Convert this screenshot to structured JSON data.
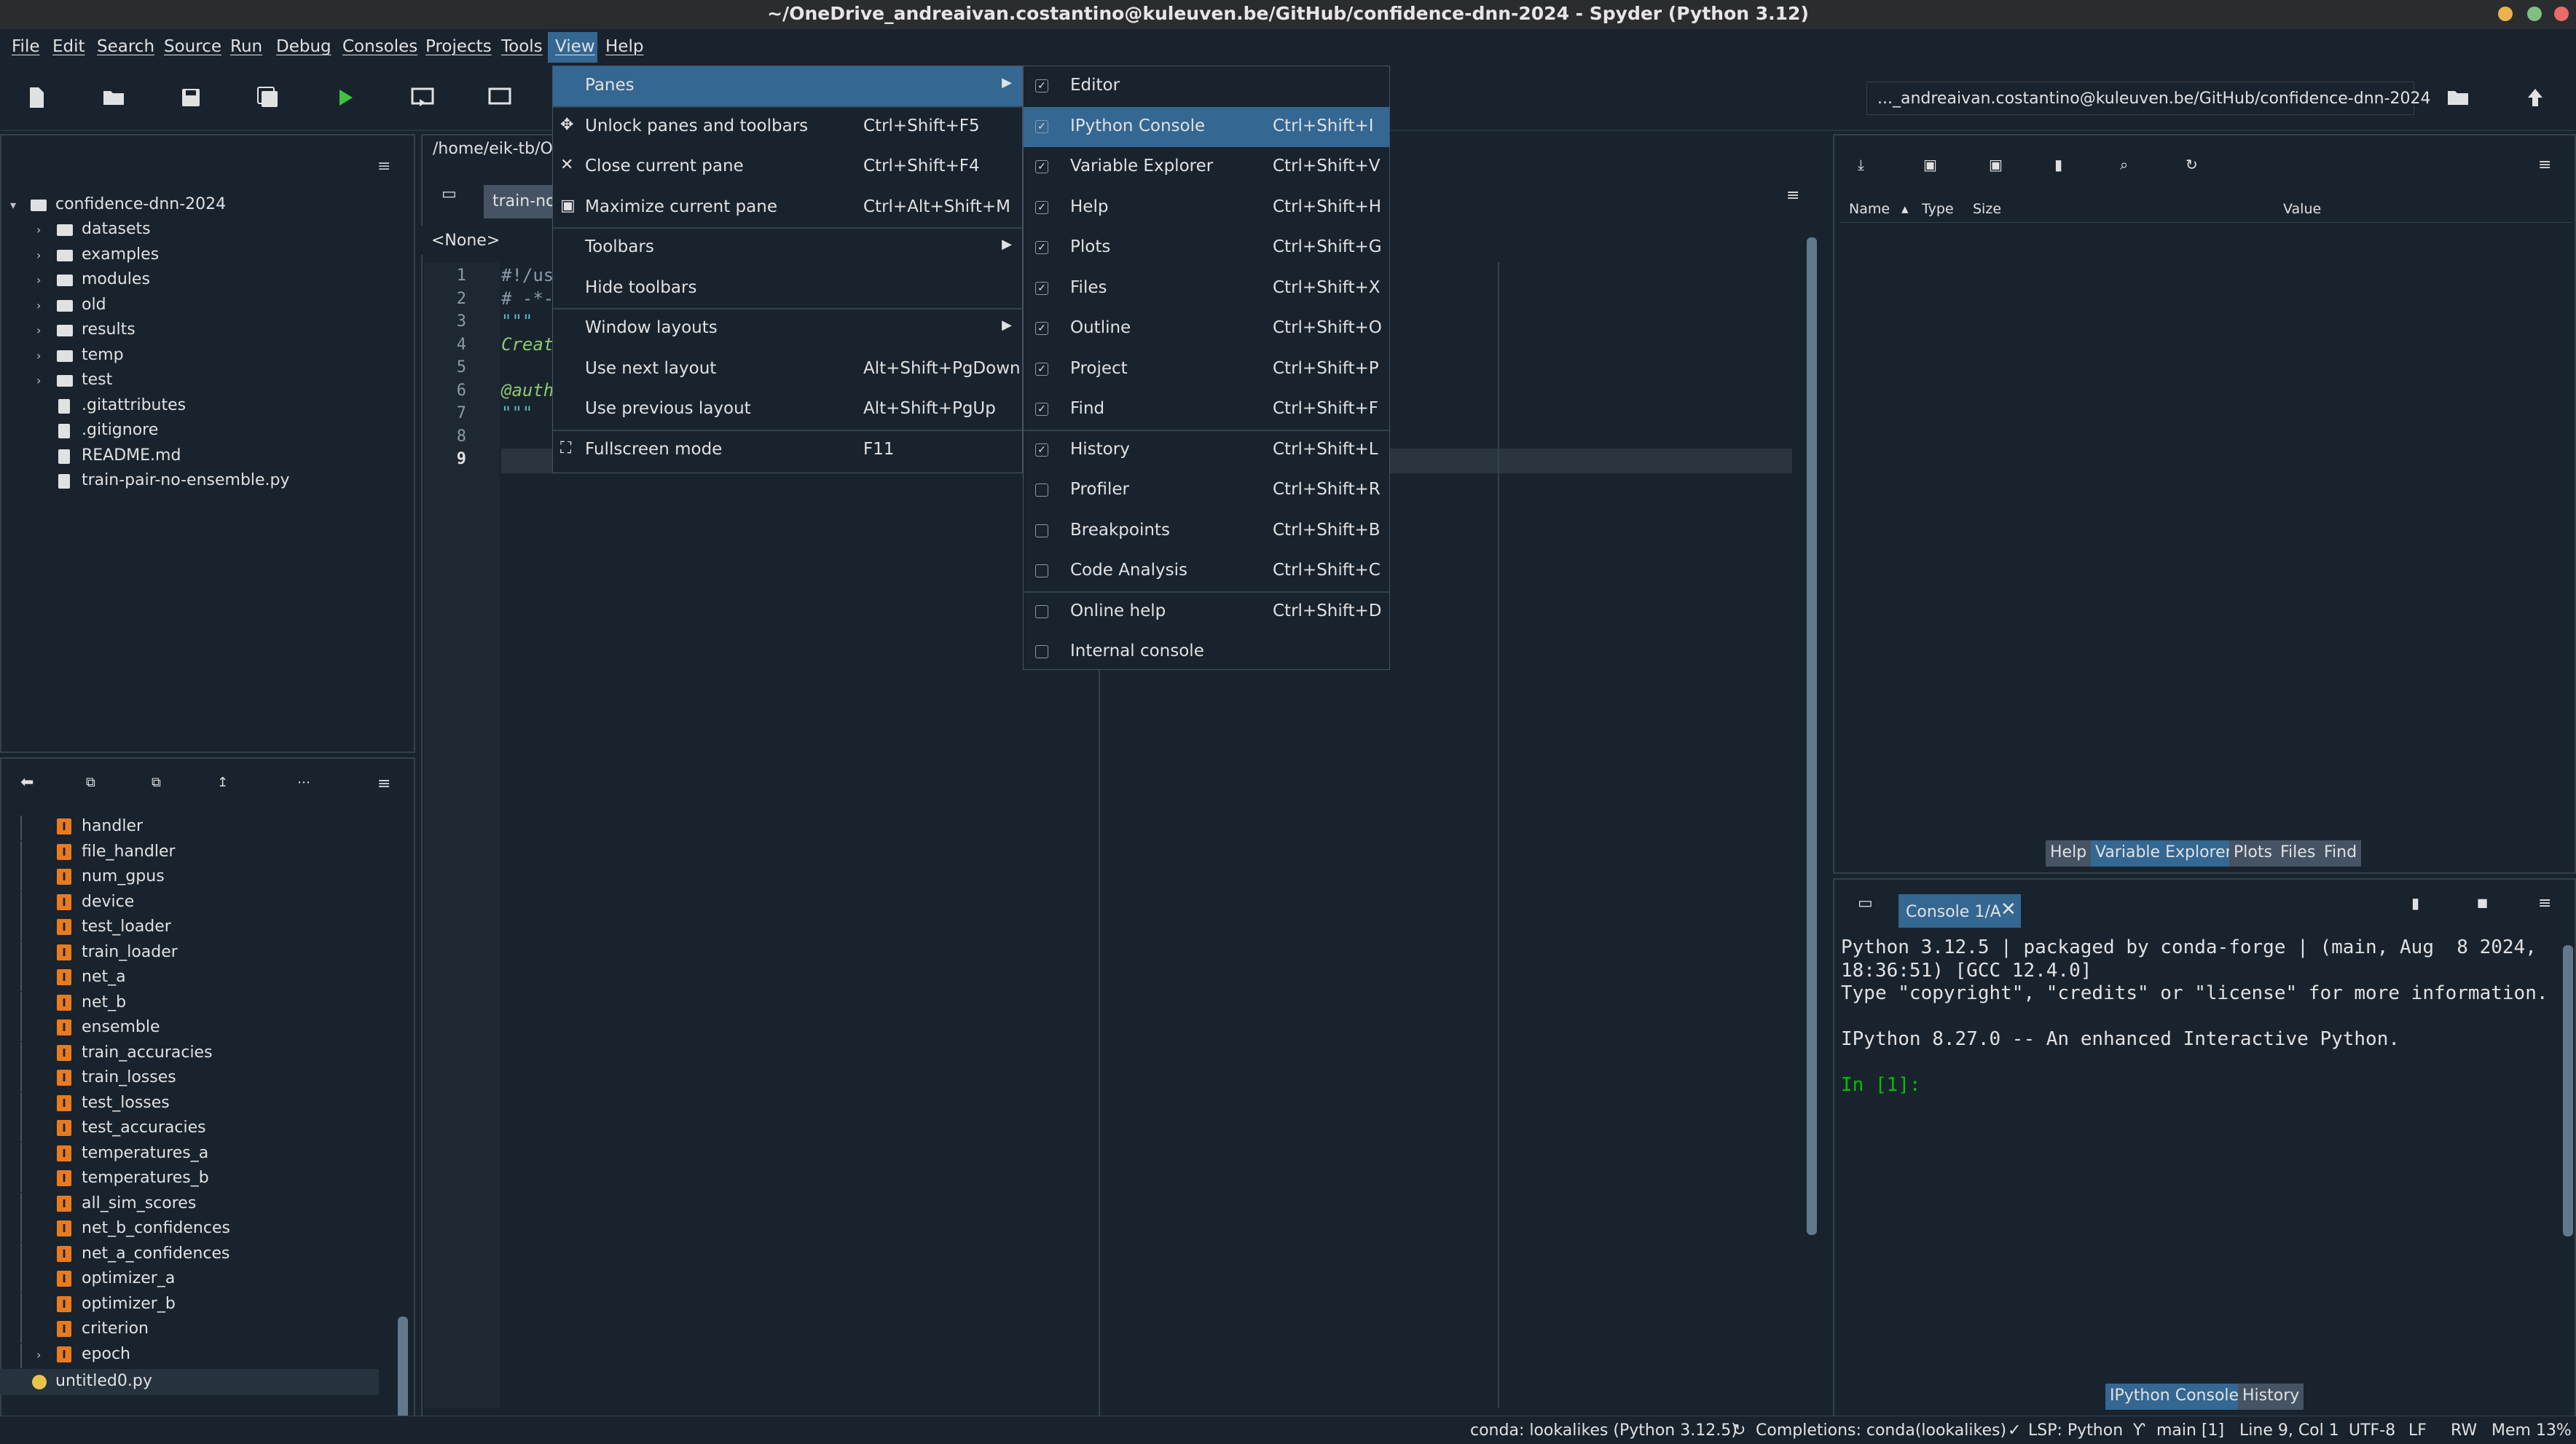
{
  "window": {
    "title": "~/OneDrive_andreaivan.costantino@kuleuven.be/GitHub/confidence-dnn-2024 - Spyder (Python 3.12)"
  },
  "menubar": [
    "File",
    "Edit",
    "Search",
    "Source",
    "Run",
    "Debug",
    "Consoles",
    "Projects",
    "Tools",
    "View",
    "Help"
  ],
  "toolbar": {
    "path": "..._andreaivan.costantino@kuleuven.be/GitHub/confidence-dnn-2024"
  },
  "files_tree": {
    "root": "confidence-dnn-2024",
    "items": [
      {
        "label": "datasets",
        "kind": "folder"
      },
      {
        "label": "examples",
        "kind": "folder"
      },
      {
        "label": "modules",
        "kind": "folder"
      },
      {
        "label": "old",
        "kind": "folder"
      },
      {
        "label": "results",
        "kind": "folder"
      },
      {
        "label": "temp",
        "kind": "folder"
      },
      {
        "label": "test",
        "kind": "folder"
      },
      {
        "label": ".gitattributes",
        "kind": "file"
      },
      {
        "label": ".gitignore",
        "kind": "file"
      },
      {
        "label": "README.md",
        "kind": "file"
      },
      {
        "label": "train-pair-no-ensemble.py",
        "kind": "file"
      }
    ]
  },
  "outline": {
    "items": [
      "handler",
      "file_handler",
      "num_gpus",
      "device",
      "test_loader",
      "train_loader",
      "net_a",
      "net_b",
      "ensemble",
      "train_accuracies",
      "train_losses",
      "test_losses",
      "test_accuracies",
      "temperatures_a",
      "temperatures_b",
      "all_sim_scores",
      "net_b_confidences",
      "net_a_confidences",
      "optimizer_a",
      "optimizer_b",
      "criterion",
      "epoch"
    ],
    "file": "untitled0.py",
    "var_glyph": "I"
  },
  "editor": {
    "path": "/home/eik-tb/Or",
    "tab": "train-no",
    "selector": "<None>",
    "line_numbers": [
      "1",
      "2",
      "3",
      "4",
      "5",
      "6",
      "7",
      "8",
      "9"
    ],
    "lines": [
      "#!/us",
      "# -*-",
      "\"\"\"",
      "Creat",
      "",
      "@auth",
      "\"\"\"",
      "",
      ""
    ]
  },
  "view_menu": {
    "items": [
      {
        "label": "Panes",
        "shortcut": "",
        "submenu": true
      },
      {
        "label": "Unlock panes and toolbars",
        "shortcut": "Ctrl+Shift+F5"
      },
      {
        "label": "Close current pane",
        "shortcut": "Ctrl+Shift+F4"
      },
      {
        "label": "Maximize current pane",
        "shortcut": "Ctrl+Alt+Shift+M"
      },
      {
        "label": "Toolbars",
        "shortcut": "",
        "submenu": true
      },
      {
        "label": "Hide toolbars",
        "shortcut": ""
      },
      {
        "label": "Window layouts",
        "shortcut": "",
        "submenu": true
      },
      {
        "label": "Use next layout",
        "shortcut": "Alt+Shift+PgDown"
      },
      {
        "label": "Use previous layout",
        "shortcut": "Alt+Shift+PgUp"
      },
      {
        "label": "Fullscreen mode",
        "shortcut": "F11"
      }
    ]
  },
  "panes_menu": {
    "items": [
      {
        "label": "Editor",
        "shortcut": "",
        "checked": true
      },
      {
        "label": "IPython Console",
        "shortcut": "Ctrl+Shift+I",
        "checked": true
      },
      {
        "label": "Variable Explorer",
        "shortcut": "Ctrl+Shift+V",
        "checked": true
      },
      {
        "label": "Help",
        "shortcut": "Ctrl+Shift+H",
        "checked": true
      },
      {
        "label": "Plots",
        "shortcut": "Ctrl+Shift+G",
        "checked": true
      },
      {
        "label": "Files",
        "shortcut": "Ctrl+Shift+X",
        "checked": true
      },
      {
        "label": "Outline",
        "shortcut": "Ctrl+Shift+O",
        "checked": true
      },
      {
        "label": "Project",
        "shortcut": "Ctrl+Shift+P",
        "checked": true
      },
      {
        "label": "Find",
        "shortcut": "Ctrl+Shift+F",
        "checked": true
      },
      {
        "label": "History",
        "shortcut": "Ctrl+Shift+L",
        "checked": true
      },
      {
        "label": "Profiler",
        "shortcut": "Ctrl+Shift+R",
        "checked": false
      },
      {
        "label": "Breakpoints",
        "shortcut": "Ctrl+Shift+B",
        "checked": false
      },
      {
        "label": "Code Analysis",
        "shortcut": "Ctrl+Shift+C",
        "checked": false
      },
      {
        "label": "Online help",
        "shortcut": "Ctrl+Shift+D",
        "checked": false
      },
      {
        "label": "Internal console",
        "shortcut": "",
        "checked": false
      }
    ]
  },
  "variable_explorer": {
    "columns": [
      "Name",
      "Type",
      "Size",
      "Value"
    ]
  },
  "top_right_tabs": [
    "Help",
    "Variable Explorer",
    "Plots",
    "Files",
    "Find"
  ],
  "console": {
    "tab": "Console 1/A",
    "lines": [
      "Python 3.12.5 | packaged by conda-forge | (main, Aug  8 2024,",
      "18:36:51) [GCC 12.4.0]",
      "Type \"copyright\", \"credits\" or \"license\" for more information.",
      "",
      "IPython 8.27.0 -- An enhanced Interactive Python.",
      "",
      "In [1]:"
    ]
  },
  "bottom_right_tabs": [
    "IPython Console",
    "History"
  ],
  "statusbar": {
    "env": "conda: lookalikes (Python 3.12.5)",
    "completions": "Completions: conda(lookalikes)",
    "lsp": "LSP: Python",
    "git": "main [1]",
    "position": "Line 9, Col 1",
    "encoding": "UTF-8",
    "eol": "LF",
    "rw": "RW",
    "mem": "Mem 13%"
  },
  "colors": {
    "background": "#19232d",
    "accent": "#346792",
    "prompt": "#00c000",
    "var_icon": "#e87b1e"
  }
}
